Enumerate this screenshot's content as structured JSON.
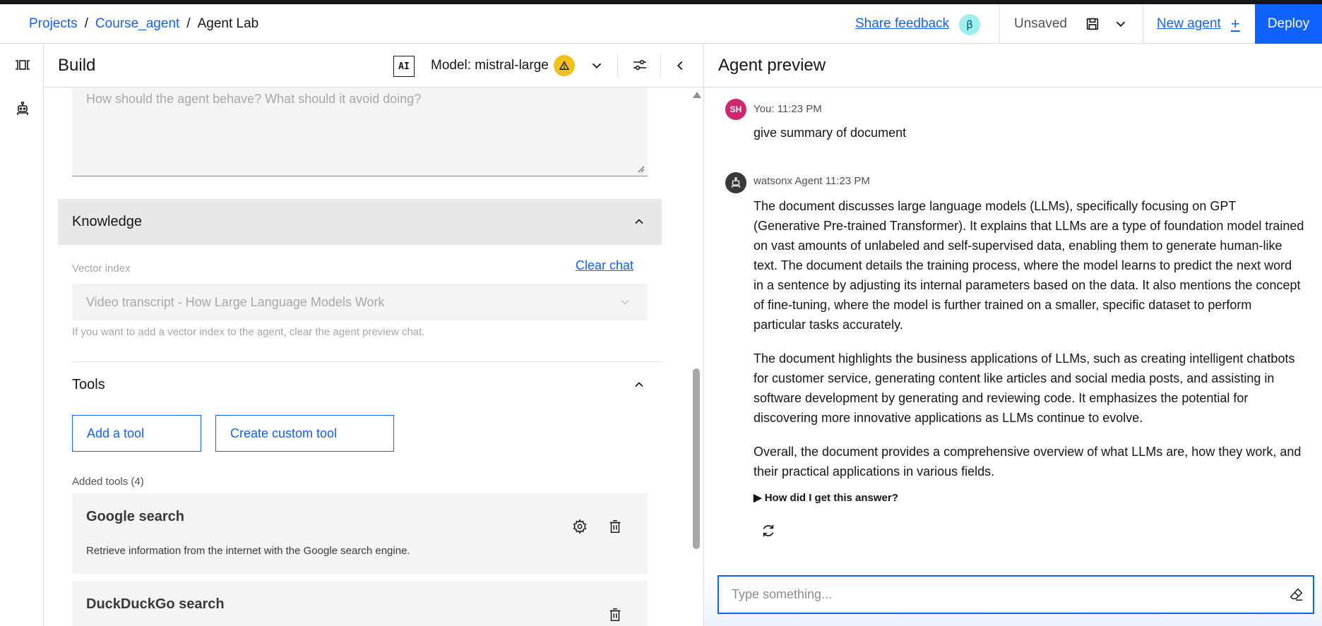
{
  "breadcrumb": {
    "projects": "Projects",
    "project": "Course_agent",
    "current": "Agent Lab",
    "separator": "/"
  },
  "header": {
    "share_feedback": "Share feedback",
    "beta": "β",
    "status": "Unsaved",
    "new_agent": "New agent",
    "new_agent_icon": "+",
    "deploy": "Deploy"
  },
  "build": {
    "title": "Build",
    "ai_badge": "AI",
    "model_label": "Model: mistral-large",
    "warning_icon": "warning-icon",
    "instructions_placeholder": "How should the agent behave? What should it avoid doing?",
    "knowledge": {
      "title": "Knowledge",
      "vector_index_label": "Vector index",
      "clear_chat": "Clear chat",
      "vector_index_value": "Video transcript - How Large Language Models Work",
      "help": "If you want to add a vector index to the agent, clear the agent preview chat."
    },
    "tools": {
      "title": "Tools",
      "add_tool": "Add a tool",
      "create_custom_tool": "Create custom tool",
      "added_label": "Added tools (4)",
      "items": [
        {
          "name": "Google search",
          "description": "Retrieve information from the internet with the Google search engine."
        },
        {
          "name": "DuckDuckGo search",
          "description": ""
        }
      ]
    }
  },
  "preview": {
    "title": "Agent preview",
    "messages": [
      {
        "avatar": "SH",
        "meta": "You: 11:23 PM",
        "text": "give summary of document"
      },
      {
        "meta": "watsonx Agent 11:23 PM",
        "paragraphs": [
          "The document discusses large language models (LLMs), specifically focusing on GPT (Generative Pre-trained Transformer). It explains that LLMs are a type of foundation model trained on vast amounts of unlabeled and self-supervised data, enabling them to generate human-like text. The document details the training process, where the model learns to predict the next word in a sentence by adjusting its internal parameters based on the data. It also mentions the concept of fine-tuning, where the model is further trained on a smaller, specific dataset to perform particular tasks accurately.",
          "The document highlights the business applications of LLMs, such as creating intelligent chatbots for customer service, generating content like articles and social media posts, and assisting in software development by generating and reviewing code. It emphasizes the potential for discovering more innovative applications as LLMs continue to evolve.",
          "Overall, the document provides a comprehensive overview of what LLMs are, how they work, and their practical applications in various fields."
        ],
        "how": "▶ How did I get this answer?"
      }
    ],
    "input_placeholder": "Type something..."
  },
  "colors": {
    "primary": "#0f62fe",
    "avatar_user": "#d02670",
    "warning": "#f1c21b",
    "beta": "#9ef0f0"
  }
}
